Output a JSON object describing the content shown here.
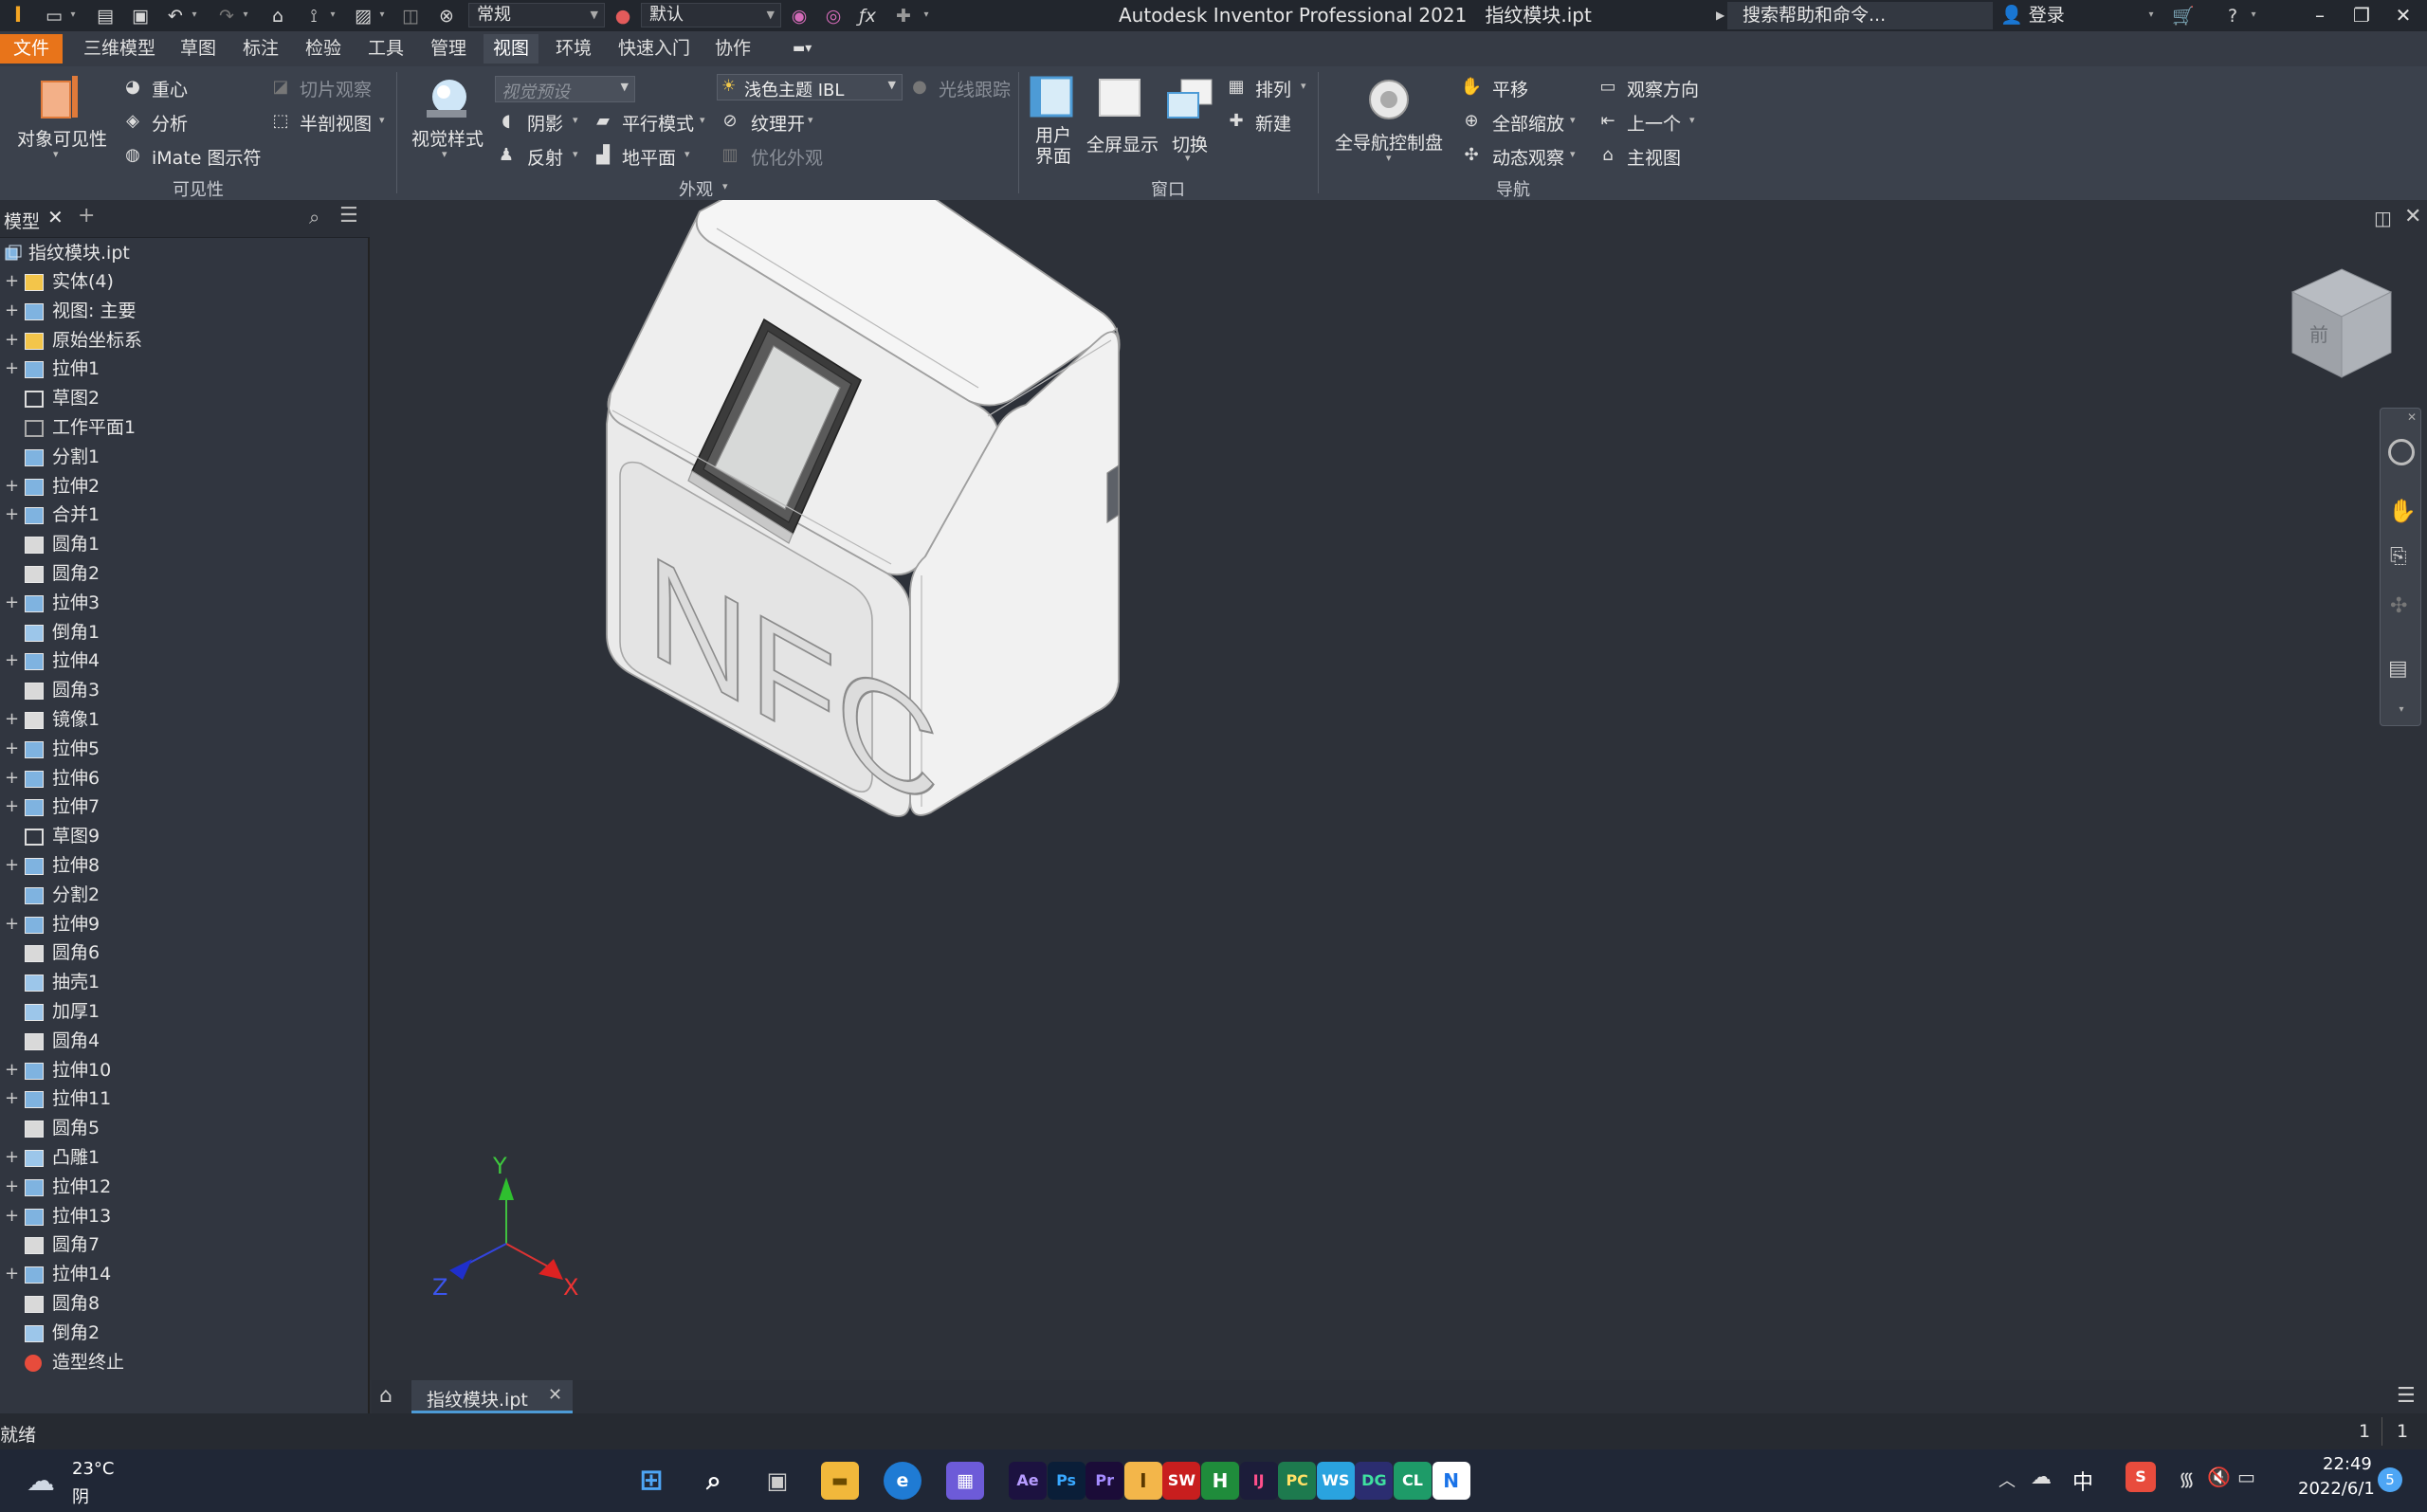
{
  "window": {
    "title": "Autodesk Inventor Professional 2021",
    "document": "指纹模块.ipt",
    "search_placeholder": "搜索帮助和命令...",
    "login": "登录",
    "quick_select1": "常规",
    "quick_select2": "默认"
  },
  "tabs": [
    "文件",
    "三维模型",
    "草图",
    "标注",
    "检验",
    "工具",
    "管理",
    "视图",
    "环境",
    "快速入门",
    "协作"
  ],
  "active_tab": "视图",
  "ribbon": {
    "visibility": {
      "title": "可见性",
      "object_visibility": "对象可见性",
      "center_of_gravity": "重心",
      "analysis": "分析",
      "imate": "iMate 图示符",
      "slice": "切片观察",
      "half_section": "半剖视图"
    },
    "appearance": {
      "title": "外观",
      "visual_style": "视觉样式",
      "view_preset": "视觉预设",
      "shadows": "阴影",
      "reflections": "反射",
      "parallel_mode": "平行模式",
      "ground_plane": "地平面",
      "lighting": "浅色主题 IBL",
      "ray_tracing": "光线跟踪",
      "texture_on": "纹理开",
      "optimize": "优化外观"
    },
    "window_group": {
      "title": "窗口",
      "user_interface": "用户界面",
      "full_screen": "全屏显示",
      "switch": "切换",
      "arrange": "排列",
      "new": "新建"
    },
    "navigate": {
      "title": "导航",
      "steering_wheel": "全导航控制盘",
      "pan": "平移",
      "zoom_all": "全部缩放",
      "orbit": "动态观察",
      "view_face": "观察方向",
      "previous": "上一个",
      "home": "主视图"
    }
  },
  "browser": {
    "tab": "模型",
    "root": "指纹模块.ipt",
    "items": [
      {
        "label": "实体(4)",
        "expand": "+",
        "icon": "folder"
      },
      {
        "label": "视图: 主要",
        "expand": "+",
        "icon": "view"
      },
      {
        "label": "原始坐标系",
        "expand": "+",
        "icon": "folder"
      },
      {
        "label": "拉伸1",
        "expand": "+",
        "icon": "extrude"
      },
      {
        "label": "草图2",
        "expand": "",
        "icon": "sketch"
      },
      {
        "label": "工作平面1",
        "expand": "",
        "icon": "plane"
      },
      {
        "label": "分割1",
        "expand": "",
        "icon": "split"
      },
      {
        "label": "拉伸2",
        "expand": "+",
        "icon": "extrude"
      },
      {
        "label": "合并1",
        "expand": "+",
        "icon": "combine"
      },
      {
        "label": "圆角1",
        "expand": "",
        "icon": "fillet"
      },
      {
        "label": "圆角2",
        "expand": "",
        "icon": "fillet"
      },
      {
        "label": "拉伸3",
        "expand": "+",
        "icon": "extrude"
      },
      {
        "label": "倒角1",
        "expand": "",
        "icon": "chamfer"
      },
      {
        "label": "拉伸4",
        "expand": "+",
        "icon": "extrude"
      },
      {
        "label": "圆角3",
        "expand": "",
        "icon": "fillet"
      },
      {
        "label": "镜像1",
        "expand": "+",
        "icon": "mirror"
      },
      {
        "label": "拉伸5",
        "expand": "+",
        "icon": "extrude"
      },
      {
        "label": "拉伸6",
        "expand": "+",
        "icon": "extrude"
      },
      {
        "label": "拉伸7",
        "expand": "+",
        "icon": "extrude"
      },
      {
        "label": "草图9",
        "expand": "",
        "icon": "sketch3d"
      },
      {
        "label": "拉伸8",
        "expand": "+",
        "icon": "extrude"
      },
      {
        "label": "分割2",
        "expand": "",
        "icon": "split"
      },
      {
        "label": "拉伸9",
        "expand": "+",
        "icon": "extrude"
      },
      {
        "label": "圆角6",
        "expand": "",
        "icon": "fillet"
      },
      {
        "label": "抽壳1",
        "expand": "",
        "icon": "shell"
      },
      {
        "label": "加厚1",
        "expand": "",
        "icon": "thicken"
      },
      {
        "label": "圆角4",
        "expand": "",
        "icon": "fillet"
      },
      {
        "label": "拉伸10",
        "expand": "+",
        "icon": "extrude"
      },
      {
        "label": "拉伸11",
        "expand": "+",
        "icon": "extrude"
      },
      {
        "label": "圆角5",
        "expand": "",
        "icon": "fillet"
      },
      {
        "label": "凸雕1",
        "expand": "+",
        "icon": "emboss"
      },
      {
        "label": "拉伸12",
        "expand": "+",
        "icon": "extrude"
      },
      {
        "label": "拉伸13",
        "expand": "+",
        "icon": "extrude"
      },
      {
        "label": "圆角7",
        "expand": "",
        "icon": "fillet"
      },
      {
        "label": "拉伸14",
        "expand": "+",
        "icon": "extrude"
      },
      {
        "label": "圆角8",
        "expand": "",
        "icon": "fillet"
      },
      {
        "label": "倒角2",
        "expand": "",
        "icon": "chamfer"
      },
      {
        "label": "造型终止",
        "expand": "",
        "icon": "end"
      }
    ]
  },
  "viewport": {
    "model_text": "NFC",
    "axis_x": "X",
    "axis_y": "Y",
    "axis_z": "Z",
    "viewcube_face": "前"
  },
  "doc_tab": "指纹模块.ipt",
  "status": {
    "text": "就绪",
    "count1": "1",
    "count2": "1"
  },
  "taskbar": {
    "weather_temp": "23°C",
    "weather_desc": "阴",
    "ime": "中",
    "time": "22:49",
    "date": "2022/6/1",
    "notifications": "5",
    "apps": [
      "Ae",
      "Ps",
      "Pr",
      "I",
      "SW",
      "H",
      "IJ",
      "PC",
      "WS",
      "DG",
      "CL",
      "N"
    ]
  }
}
